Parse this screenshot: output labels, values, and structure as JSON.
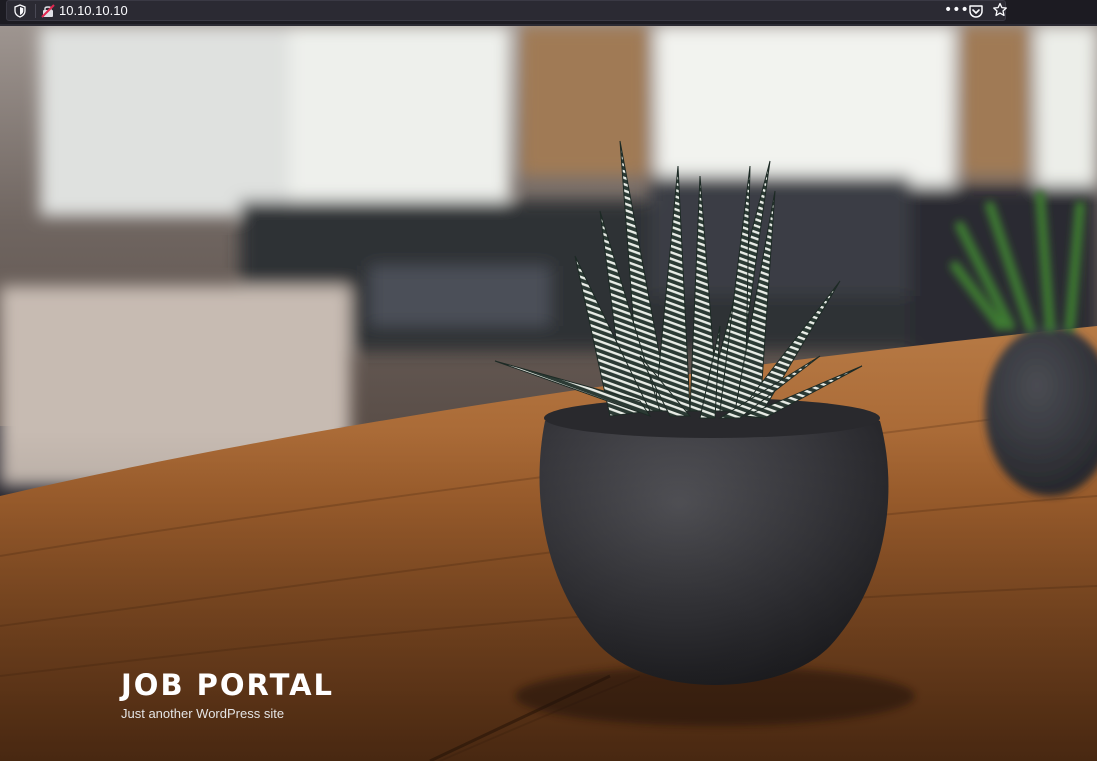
{
  "browser": {
    "url": "10.10.10.10",
    "page_actions_label": "•••"
  },
  "site": {
    "title": "JOB PORTAL",
    "description": "Just another WordPress site"
  },
  "colors": {
    "chrome_bg": "#1c1b22",
    "urlbar_bg": "#2b2a33",
    "insecure_icon": "#e22850",
    "text": "#fbfbfe"
  },
  "icons": {
    "tracking_protection": "shield-icon",
    "connection": "insecure-lock-icon",
    "pocket": "pocket-icon",
    "bookmark": "star-icon"
  }
}
